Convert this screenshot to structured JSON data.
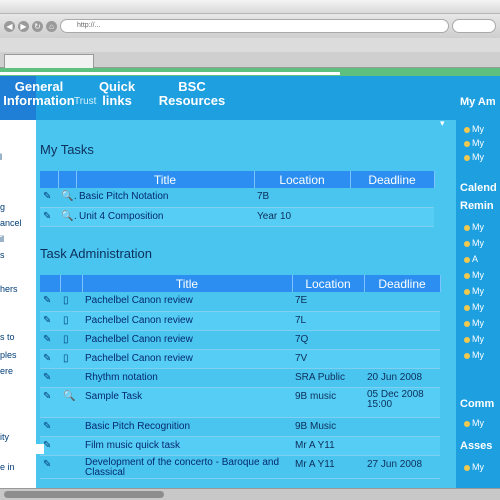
{
  "browser": {
    "url": "http://...",
    "tab_title": "",
    "bookmarks": [
      "",
      "",
      "",
      "",
      ""
    ]
  },
  "nav": {
    "items": [
      {
        "label": "General Information"
      },
      {
        "label": "Quick links"
      },
      {
        "label": "BSC Resources"
      }
    ],
    "sub_label": "Trust"
  },
  "left_panel": {
    "fragments": [
      "l",
      "g",
      "ancel",
      "il",
      "s",
      "hers",
      "s to",
      "ples",
      "ere",
      "ity",
      "e in"
    ]
  },
  "my_tasks": {
    "title": "My Tasks",
    "columns": [
      "Title",
      "Location",
      "Deadline"
    ],
    "rows": [
      {
        "title": "Basic Pitch Notation",
        "location": "7B",
        "deadline": ""
      },
      {
        "title": "Unit 4 Composition",
        "location": "Year 10",
        "deadline": ""
      }
    ]
  },
  "task_admin": {
    "title": "Task Administration",
    "columns": [
      "Title",
      "Location",
      "Deadline"
    ],
    "rows": [
      {
        "title": "Pachelbel Canon review",
        "location": "7E",
        "deadline": ""
      },
      {
        "title": "Pachelbel Canon review",
        "location": "7L",
        "deadline": ""
      },
      {
        "title": "Pachelbel Canon review",
        "location": "7Q",
        "deadline": ""
      },
      {
        "title": "Pachelbel Canon review",
        "location": "7V",
        "deadline": ""
      },
      {
        "title": "Rhythm notation",
        "location": "SRA Public",
        "deadline": "20 Jun 2008"
      },
      {
        "title": "Sample Task",
        "location": "9B music",
        "deadline": "05 Dec 2008 15:00"
      },
      {
        "title": "Basic Pitch Recognition",
        "location": "9B Music",
        "deadline": ""
      },
      {
        "title": "Film music quick task",
        "location": "Mr A Y11",
        "deadline": ""
      },
      {
        "title": "Development of the concerto - Baroque and Classical",
        "location": "Mr A Y11",
        "deadline": "27 Jun 2008"
      }
    ]
  },
  "right_panel": {
    "heading1": "My Am",
    "items1": [
      "My",
      "My",
      "My"
    ],
    "heading2": "Calend",
    "heading3": "Remin",
    "items2": [
      "My",
      "My",
      "A",
      "My",
      "My",
      "My",
      "My",
      "My",
      "My"
    ],
    "heading4": "Comm",
    "items3": [
      "My"
    ],
    "heading5": "Asses",
    "items4": [
      "My"
    ]
  },
  "colors": {
    "accent": "#1e9fe0",
    "background": "#49c5f0",
    "table_header": "#2b8ef0"
  }
}
